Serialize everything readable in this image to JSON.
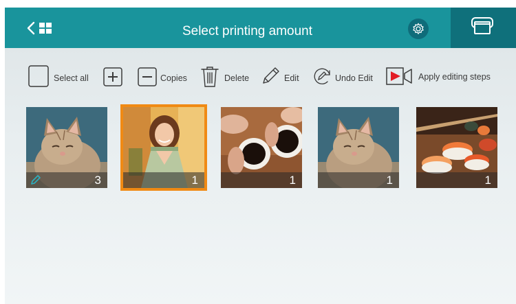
{
  "header": {
    "title": "Select printing amount",
    "back_icon": "chevron-left-icon",
    "grid_icon": "grid-icon",
    "settings_icon": "gear-icon",
    "print_icon": "printer-icon",
    "bar_color": "#19949c",
    "print_bg": "#0f707b"
  },
  "toolbar": {
    "select_all": "Select all",
    "copies": "Copies",
    "delete": "Delete",
    "edit": "Edit",
    "undo_edit": "Undo Edit",
    "apply_steps": "Apply editing steps"
  },
  "photos": [
    {
      "subject": "kitten",
      "count": "3",
      "edited": true,
      "selected": false
    },
    {
      "subject": "woman",
      "count": "1",
      "edited": false,
      "selected": true
    },
    {
      "subject": "coffee-cups",
      "count": "1",
      "edited": false,
      "selected": false
    },
    {
      "subject": "kitten",
      "count": "1",
      "edited": false,
      "selected": false
    },
    {
      "subject": "sushi",
      "count": "1",
      "edited": false,
      "selected": false
    }
  ],
  "colors": {
    "selection": "#f08a14",
    "edited_icon": "#2bb0c0",
    "apply_icon": "#e21c24"
  }
}
